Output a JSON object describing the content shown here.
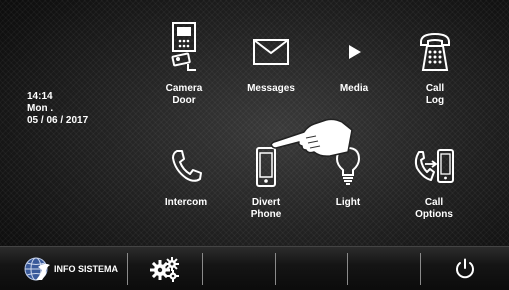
{
  "status": {
    "time": "14:14",
    "day": "Mon .",
    "date": "05 / 06 / 2017"
  },
  "menu": {
    "camera_door": {
      "label": "Camera\nDoor",
      "icon": "camera-door-icon"
    },
    "messages": {
      "label": "Messages",
      "icon": "envelope-icon"
    },
    "media": {
      "label": "Media",
      "icon": "play-icon"
    },
    "call_log": {
      "label": "Call\nLog",
      "icon": "telephone-icon"
    },
    "intercom": {
      "label": "Intercom",
      "icon": "handset-icon"
    },
    "divert_phone": {
      "label": "Divert\nPhone",
      "icon": "smartphone-icon"
    },
    "light": {
      "label": "Light",
      "icon": "lightbulb-icon"
    },
    "call_options": {
      "label": "Call\nOptions",
      "icon": "call-forward-icon"
    }
  },
  "taskbar": {
    "info_label": "INFO SISTEMA",
    "info_icon": "globe-icon",
    "settings_icon": "gears-icon",
    "power_icon": "power-icon"
  },
  "colors": {
    "text": "#ffffff",
    "icon": "#ffffff"
  }
}
